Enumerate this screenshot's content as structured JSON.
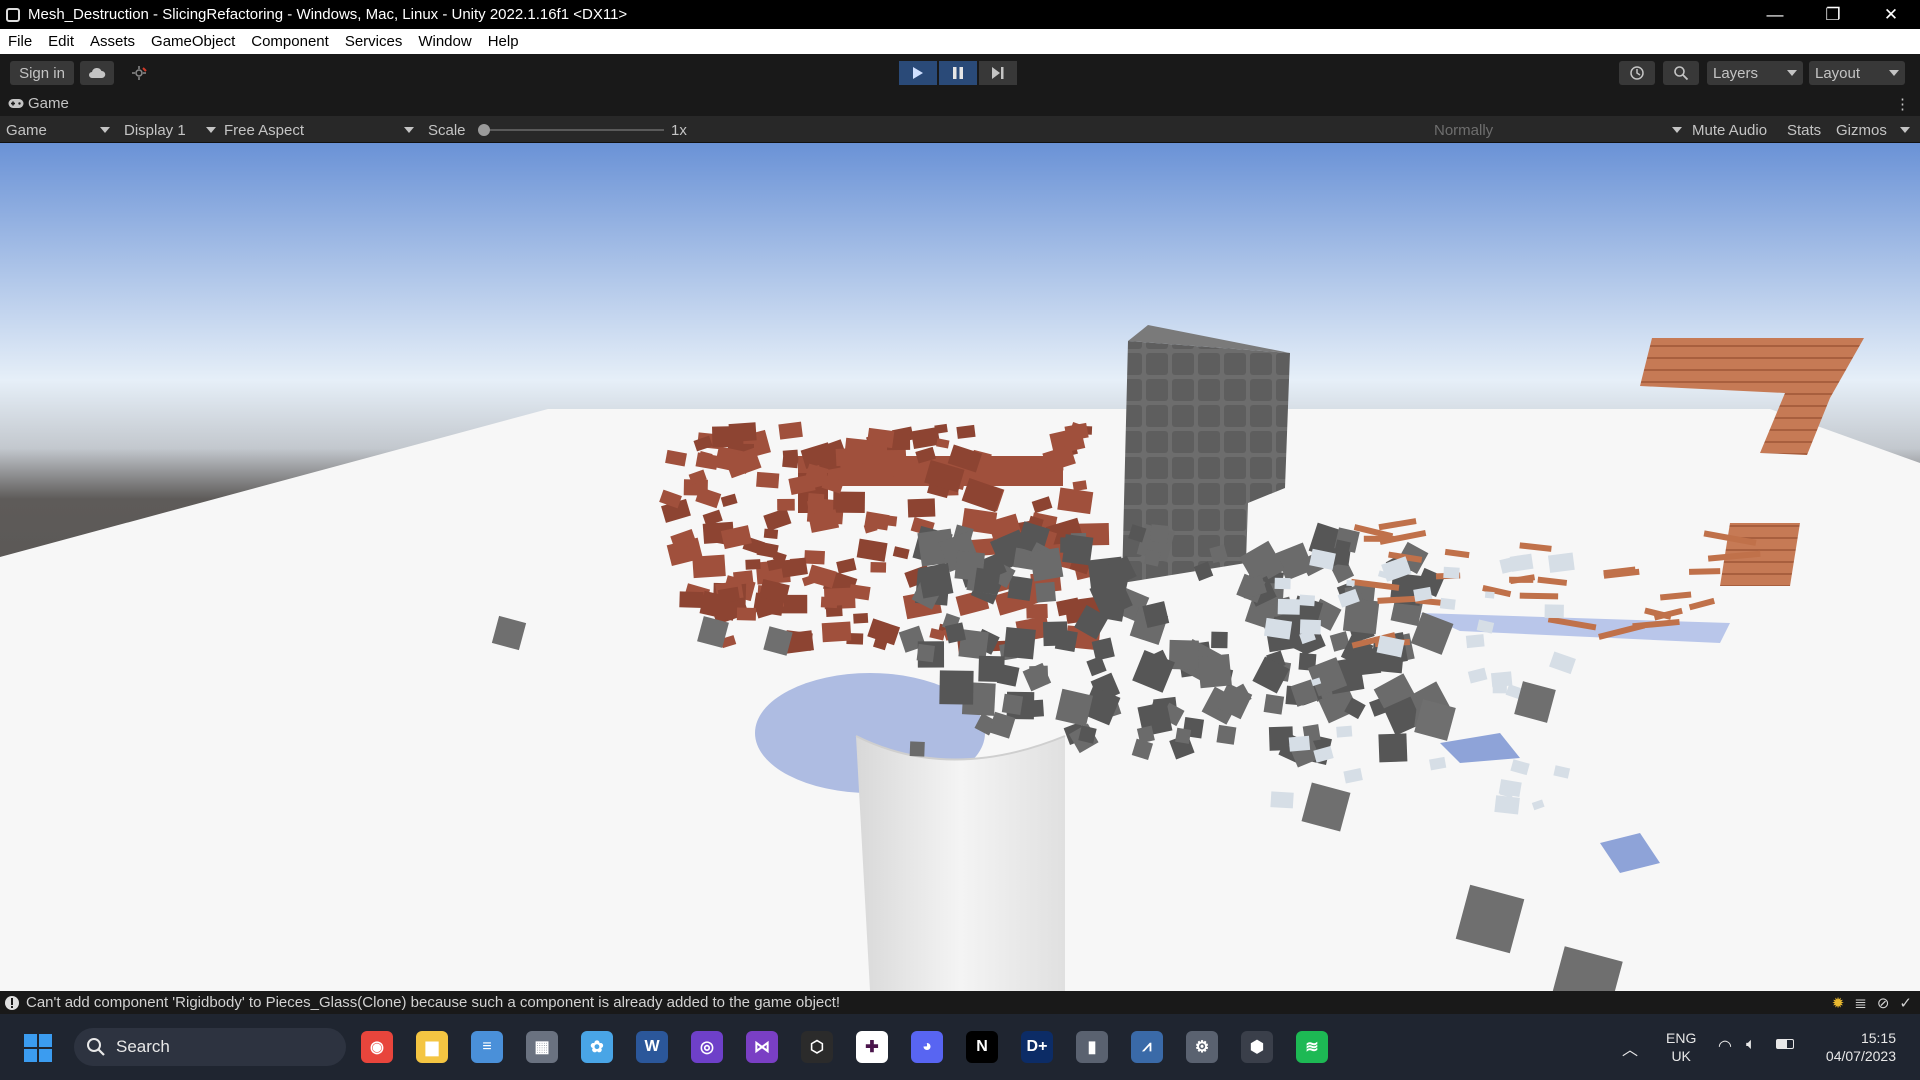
{
  "window": {
    "title": "Mesh_Destruction - SlicingRefactoring - Windows, Mac, Linux - Unity 2022.1.16f1 <DX11>",
    "minimize_glyph": "—",
    "restore_glyph": "❐",
    "close_glyph": "✕"
  },
  "menu": [
    "File",
    "Edit",
    "Assets",
    "GameObject",
    "Component",
    "Services",
    "Window",
    "Help"
  ],
  "toolbar": {
    "sign_in": "Sign in",
    "layers": "Layers",
    "layout": "Layout"
  },
  "game_tab": {
    "label": "Game"
  },
  "game_toolbar": {
    "mode": "Game",
    "display": "Display 1",
    "aspect": "Free Aspect",
    "scale_label": "Scale",
    "scale_value": "1x",
    "scale_fraction": 0.0,
    "vsync": "Normally",
    "mute_audio": "Mute Audio",
    "stats": "Stats",
    "gizmos": "Gizmos"
  },
  "status": {
    "message": "Can't add component 'Rigidbody' to Pieces_Glass(Clone) because such a component is already added to the game object!"
  },
  "taskbar": {
    "search_label": "Search",
    "language_top": "ENG",
    "language_bottom": "UK",
    "time": "15:15",
    "date": "04/07/2023",
    "apps": [
      {
        "name": "chrome-icon",
        "color": "#e8453c",
        "glyph": "◉"
      },
      {
        "name": "file-explorer-icon",
        "color": "#f4c542",
        "glyph": "▆"
      },
      {
        "name": "notepad-icon",
        "color": "#4a90d9",
        "glyph": "≡"
      },
      {
        "name": "calculator-icon",
        "color": "#6a7280",
        "glyph": "▦"
      },
      {
        "name": "paint-icon",
        "color": "#49a5e6",
        "glyph": "✿"
      },
      {
        "name": "word-icon",
        "color": "#2b579a",
        "glyph": "W"
      },
      {
        "name": "github-desktop-icon",
        "color": "#6e40c9",
        "glyph": "◎"
      },
      {
        "name": "visual-studio-icon",
        "color": "#7a3fc4",
        "glyph": "⋈"
      },
      {
        "name": "unity-hub-icon",
        "color": "#2b2b2b",
        "glyph": "⬡"
      },
      {
        "name": "slack-icon",
        "color": "#ffffff",
        "glyph": "✚"
      },
      {
        "name": "discord-icon",
        "color": "#5865f2",
        "glyph": "◕"
      },
      {
        "name": "netflix-icon",
        "color": "#000000",
        "glyph": "N"
      },
      {
        "name": "disney-plus-icon",
        "color": "#0c2c66",
        "glyph": "D+"
      },
      {
        "name": "voice-recorder-icon",
        "color": "#5a6270",
        "glyph": "▮"
      },
      {
        "name": "resource-monitor-icon",
        "color": "#3a6aa8",
        "glyph": "⩘"
      },
      {
        "name": "settings-icon",
        "color": "#5a6270",
        "glyph": "⚙"
      },
      {
        "name": "unity-editor-icon",
        "color": "#3a3f4a",
        "glyph": "⬢"
      },
      {
        "name": "spotify-icon",
        "color": "#1db954",
        "glyph": "≋"
      }
    ]
  },
  "colors": {
    "titlebar": "#000000",
    "editor_bg": "#191919",
    "play_active": "#2a4a78",
    "brick": "#a0503c",
    "stone": "#6b6b6b",
    "wood": "#c0714a"
  }
}
